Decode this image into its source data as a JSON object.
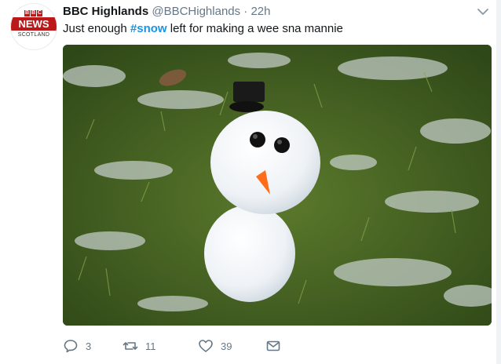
{
  "tweet": {
    "author_name": "BBC Highlands",
    "handle": "@BBCHighlands",
    "separator": "·",
    "time": "22h",
    "text_before": "Just enough ",
    "hashtag": "#snow",
    "text_after": " left for making a wee sna mannie",
    "avatar": {
      "logo_letters": [
        "B",
        "B",
        "C"
      ],
      "line1": "NEWS",
      "line2": "SCOTLAND",
      "color": "#bb1919"
    },
    "actions": {
      "replies": "3",
      "retweets": "11",
      "likes": "39"
    }
  },
  "colors": {
    "text": "#14171a",
    "muted": "#657786",
    "link": "#1b95e0"
  },
  "icons": {
    "menu": "chevron-down-icon",
    "reply": "reply-icon",
    "retweet": "retweet-icon",
    "like": "heart-icon",
    "dm": "envelope-icon"
  }
}
